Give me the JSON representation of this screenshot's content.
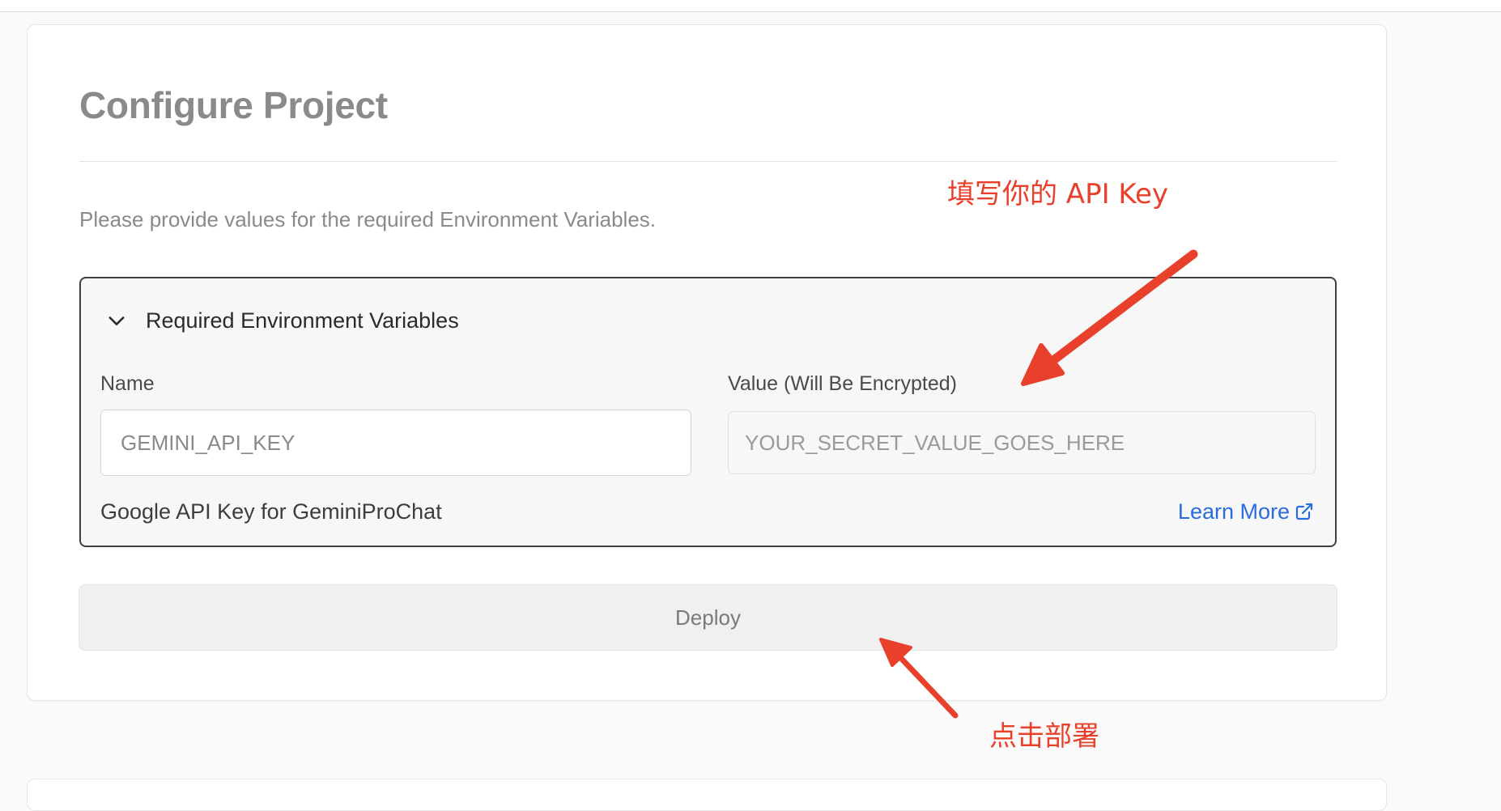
{
  "page": {
    "title": "Configure Project",
    "subtitle": "Please provide values for the required Environment Variables."
  },
  "env_panel": {
    "header": "Required Environment Variables",
    "name_label": "Name",
    "value_label": "Value (Will Be Encrypted)",
    "name_value": "GEMINI_API_KEY",
    "value_placeholder": "YOUR_SECRET_VALUE_GOES_HERE",
    "helper_text": "Google API Key for GeminiProChat",
    "learn_more_label": "Learn More"
  },
  "deploy": {
    "label": "Deploy"
  },
  "annotations": {
    "top_note": "填写你的 API Key",
    "bottom_note": "点击部署",
    "color": "#e8402a"
  },
  "icons": {
    "collapse": "chevron-down-icon",
    "external_link": "external-link-icon"
  },
  "colors": {
    "link": "#2a6be0",
    "panel_border": "#404040"
  }
}
